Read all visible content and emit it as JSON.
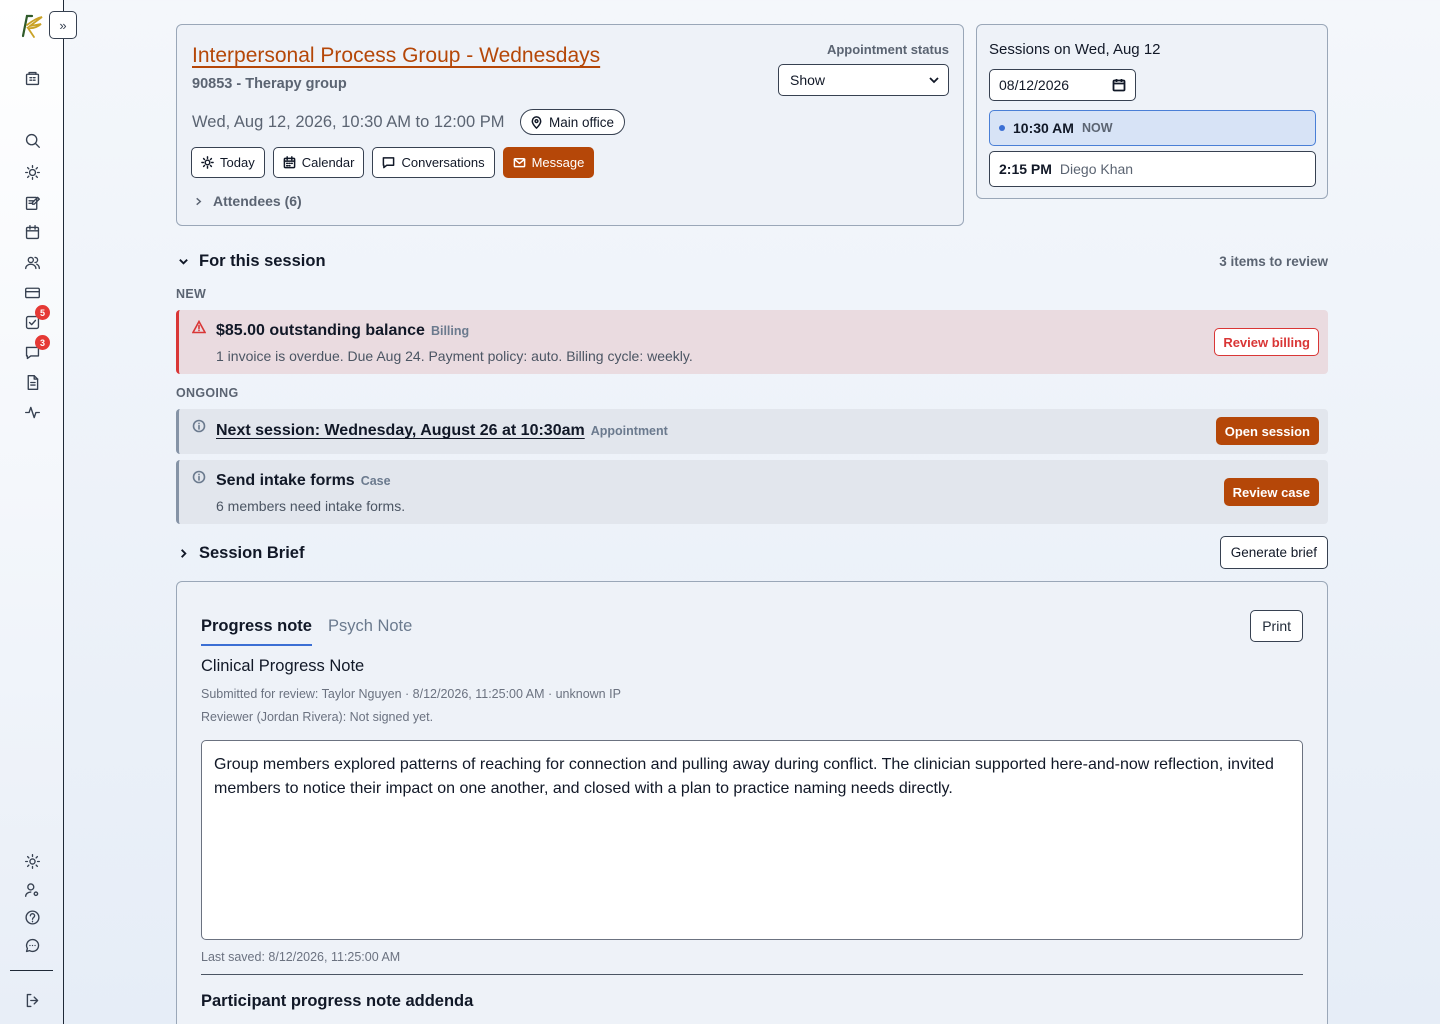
{
  "appointment": {
    "title": "Interpersonal Process Group - Wednesdays",
    "code": "90853 - Therapy group",
    "when": "Wed, Aug 12, 2026, 10:30 AM to 12:00 PM",
    "location": "Main office",
    "status_label": "Appointment status",
    "status_value": "Show",
    "buttons": {
      "today": "Today",
      "calendar": "Calendar",
      "conversations": "Conversations",
      "message": "Message"
    },
    "attendees": "Attendees (6)"
  },
  "sessions": {
    "title": "Sessions on Wed, Aug 12",
    "date_value": "08/12/2026",
    "slots": [
      {
        "time": "10:30 AM",
        "sub": "NOW",
        "active": true
      },
      {
        "time": "2:15 PM",
        "sub": "Diego Khan",
        "active": false
      }
    ]
  },
  "session_section": {
    "title": "For this session",
    "review_count": "3 items to review",
    "group_new": "NEW",
    "group_ongoing": "ONGOING",
    "alerts": [
      {
        "title": "$85.00 outstanding balance",
        "tag": "Billing",
        "desc": "1 invoice is overdue. Due Aug 24. Payment policy: auto. Billing cycle: weekly.",
        "action": "Review billing"
      },
      {
        "title": "Next session: Wednesday, August 26 at 10:30am",
        "tag": "Appointment",
        "desc": "",
        "action": "Open session"
      },
      {
        "title": "Send intake forms",
        "tag": "Case",
        "desc": "6 members need intake forms.",
        "action": "Review case"
      }
    ]
  },
  "brief": {
    "title": "Session Brief",
    "generate": "Generate brief"
  },
  "note": {
    "tabs": [
      "Progress note",
      "Psych Note"
    ],
    "print": "Print",
    "title": "Clinical Progress Note",
    "submitted": "Submitted for review: Taylor Nguyen · 8/12/2026, 11:25:00 AM · unknown IP",
    "reviewer": "Reviewer (Jordan Rivera): Not signed yet.",
    "body": "Group members explored patterns of reaching for connection and pulling away during conflict. The clinician supported here-and-now reflection, invited members to notice their impact on one another, and closed with a plan to practice naming needs directly.",
    "last_saved": "Last saved: 8/12/2026, 11:25:00 AM",
    "addenda_title": "Participant progress note addenda"
  },
  "sidebar": {
    "badges": {
      "tasks": "5",
      "messages": "3"
    }
  },
  "colors": {
    "accent": "#b54708",
    "danger": "#d93636",
    "active_blue": "#3b6fd4"
  }
}
